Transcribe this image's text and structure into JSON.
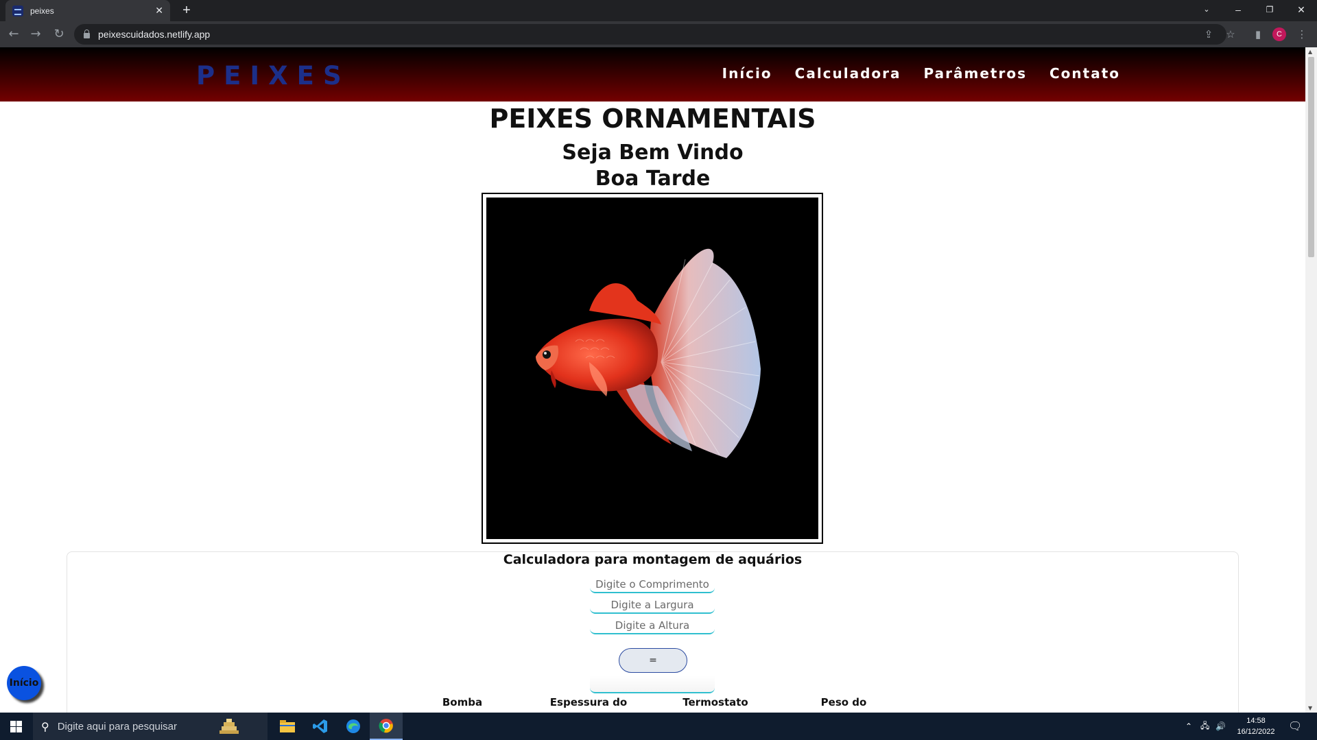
{
  "browser": {
    "tab_title": "peixes",
    "url": "peixescuidados.netlify.app",
    "profile_initial": "C"
  },
  "site": {
    "logo": "PEIXES",
    "nav": [
      "Início",
      "Calculadora",
      "Parâmetros",
      "Contato"
    ],
    "title": "PEIXES ORNAMENTAIS",
    "welcome": "Seja Bem Vindo",
    "greeting": "Boa Tarde",
    "hero_image": "betta-fish-red-white-on-black"
  },
  "calculator": {
    "title": "Calculadora para montagem de aquários",
    "length_placeholder": "Digite o Comprimento",
    "width_placeholder": "Digite a Largura",
    "height_placeholder": "Digite a Altura",
    "equals_label": "=",
    "result_labels": [
      "Bomba",
      "Espessura do",
      "Termostato",
      "Peso do"
    ]
  },
  "fab_label": "Início",
  "taskbar": {
    "search_placeholder": "Digite aqui para pesquisar",
    "time": "14:58",
    "date": "16/12/2022"
  },
  "colors": {
    "header_gradient_top": "#000000",
    "header_gradient_bottom": "#740000",
    "logo": "#1c2f8a",
    "accent_underline": "#2fbfcf",
    "fab": "#0a52e0"
  }
}
